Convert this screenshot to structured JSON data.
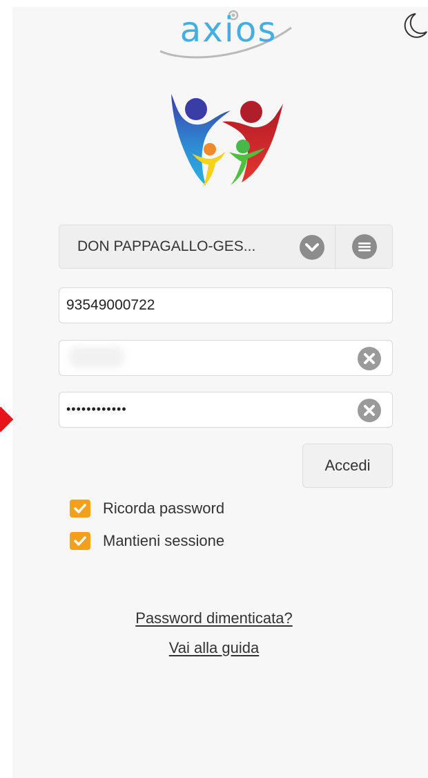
{
  "brand": {
    "name": "axios",
    "color": "#45aee0"
  },
  "theme_toggle": {
    "icon": "moon-icon"
  },
  "school_selector": {
    "selected": "DON PAPPAGALLO-GES...",
    "dropdown_icon": "chevron-down-icon",
    "menu_icon": "hamburger-menu-icon"
  },
  "fields": {
    "customer_code": {
      "value": "93549000722"
    },
    "username": {
      "value": ""
    },
    "password": {
      "value": "••••••••••••"
    }
  },
  "buttons": {
    "login": "Accedi"
  },
  "options": [
    {
      "label": "Ricorda password",
      "checked": true
    },
    {
      "label": "Mantieni sessione",
      "checked": true
    }
  ],
  "links": {
    "forgot_password": "Password dimenticata?",
    "guide": "Vai alla guida"
  },
  "colors": {
    "accent": "#f4a01b",
    "arrow": "#e8141c"
  }
}
